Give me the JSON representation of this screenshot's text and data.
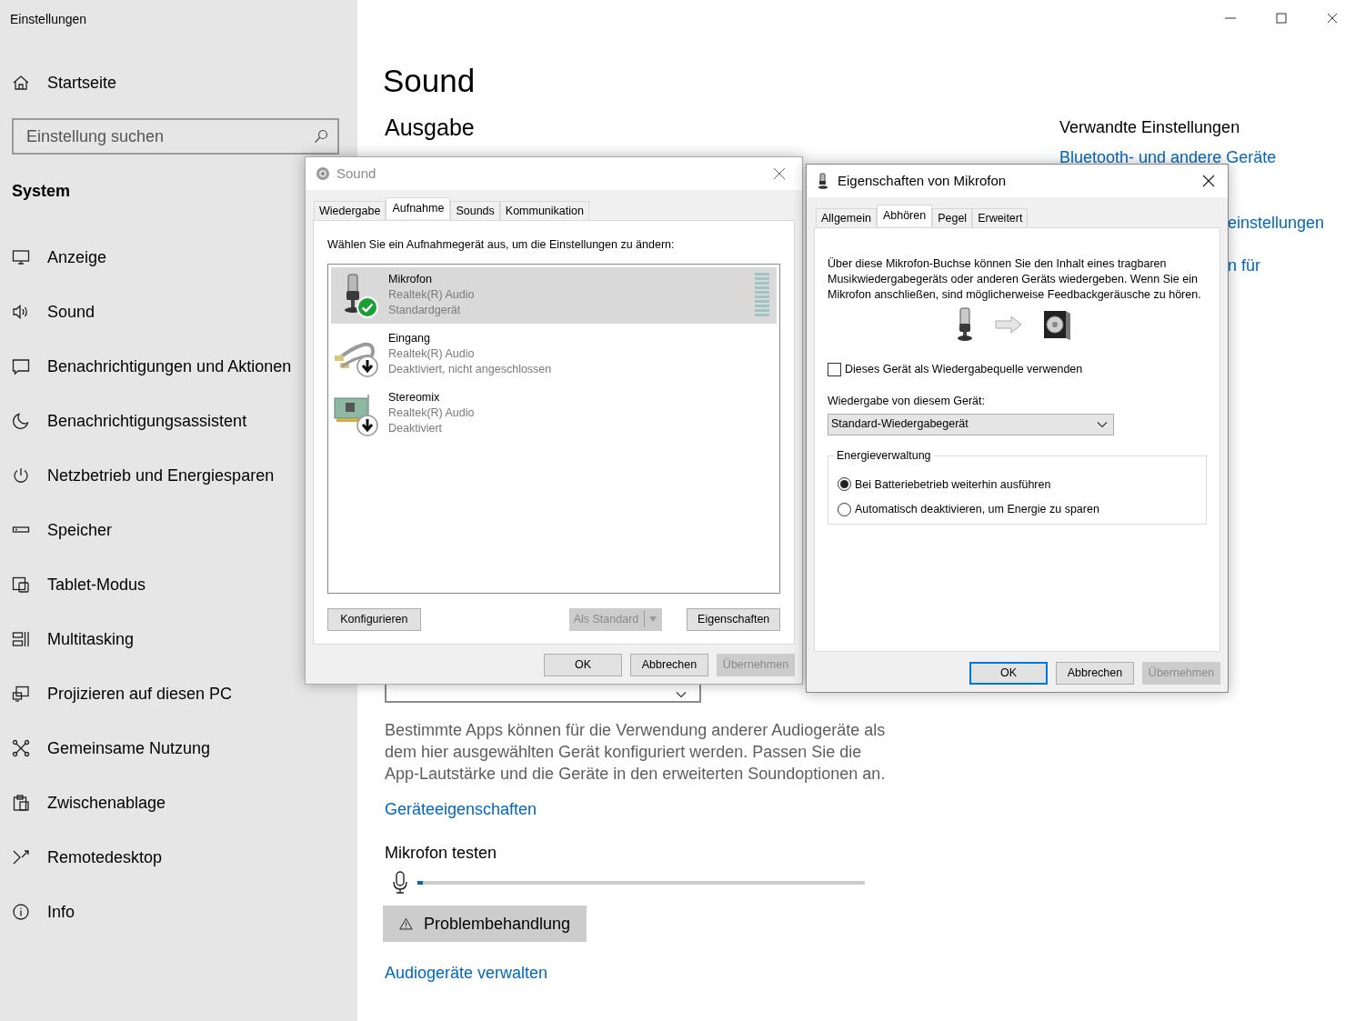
{
  "window": {
    "title": "Einstellungen"
  },
  "sidebar": {
    "home": "Startseite",
    "search": {
      "placeholder": "Einstellung suchen"
    },
    "section": "System",
    "items": [
      {
        "label": "Anzeige"
      },
      {
        "label": "Sound"
      },
      {
        "label": "Benachrichtigungen und Aktionen"
      },
      {
        "label": "Benachrichtigungsassistent"
      },
      {
        "label": "Netzbetrieb und Energiesparen"
      },
      {
        "label": "Speicher"
      },
      {
        "label": "Tablet-Modus"
      },
      {
        "label": "Multitasking"
      },
      {
        "label": "Projizieren auf diesen PC"
      },
      {
        "label": "Gemeinsame Nutzung"
      },
      {
        "label": "Zwischenablage"
      },
      {
        "label": "Remotedesktop"
      },
      {
        "label": "Info"
      }
    ]
  },
  "page": {
    "title": "Sound",
    "output_heading": "Ausgabe",
    "description": "Bestimmte Apps können für die Verwendung anderer Audiogeräte als dem hier ausgewählten Gerät konfiguriert werden. Passen Sie die App-Lautstärke und die Geräte in den erweiterten Soundoptionen an.",
    "device_properties_link": "Geräteeigenschaften",
    "test_heading": "Mikrofon testen",
    "test_meter": {
      "level": 0.012
    },
    "troubleshoot_button": "Problembehandlung",
    "manage_link": "Audiogeräte verwalten"
  },
  "related": {
    "heading": "Verwandte Einstellungen",
    "link": "Bluetooth- und andere Geräte",
    "fragments": [
      "einstellungen",
      "n für"
    ]
  },
  "sound_dialog": {
    "title": "Sound",
    "tabs": [
      {
        "label": "Wiedergabe",
        "selected": false
      },
      {
        "label": "Aufnahme",
        "selected": true
      },
      {
        "label": "Sounds",
        "selected": false
      },
      {
        "label": "Kommunikation",
        "selected": false
      }
    ],
    "instruction": "Wählen Sie ein Aufnahmegerät aus, um die Einstellungen zu ändern:",
    "devices": [
      {
        "name": "Mikrofon",
        "driver": "Realtek(R) Audio",
        "status": "Standardgerät",
        "kind": "microphone",
        "disabled": false,
        "selected": true
      },
      {
        "name": "Eingang",
        "driver": "Realtek(R) Audio",
        "status": "Deaktiviert, nicht angeschlossen",
        "kind": "cable",
        "disabled": true,
        "selected": false
      },
      {
        "name": "Stereomix",
        "driver": "Realtek(R) Audio",
        "status": "Deaktiviert",
        "kind": "card",
        "disabled": true,
        "selected": false
      }
    ],
    "buttons": [
      {
        "label": "Konfigurieren",
        "disabled": false,
        "kind": "plain"
      },
      {
        "label": "Als Standard",
        "disabled": true,
        "kind": "split"
      },
      {
        "label": "Eigenschaften",
        "disabled": false,
        "kind": "plain"
      }
    ],
    "footer_buttons": [
      {
        "label": "OK",
        "disabled": false,
        "default": false
      },
      {
        "label": "Abbrechen",
        "disabled": false,
        "default": false
      },
      {
        "label": "Übernehmen",
        "disabled": true,
        "default": false
      }
    ]
  },
  "properties_dialog": {
    "title": "Eigenschaften von Mikrofon",
    "tabs": [
      {
        "label": "Allgemein",
        "selected": false
      },
      {
        "label": "Abhören",
        "selected": true
      },
      {
        "label": "Pegel",
        "selected": false
      },
      {
        "label": "Erweitert",
        "selected": false
      }
    ],
    "description": "Über diese Mikrofon-Buchse können Sie den Inhalt eines tragbaren Musikwiedergabegeräts oder anderen Geräts wiedergeben. Wenn Sie ein Mikrofon anschließen, sind möglicherweise Feedbackgeräusche zu hören.",
    "play_through": {
      "label": "Dieses Gerät als Wiedergabequelle verwenden",
      "checked": false
    },
    "playback_label": "Wiedergabe von diesem Gerät:",
    "playback_device": {
      "value": "Standard-Wiedergabegerät"
    },
    "power": {
      "legend": "Energieverwaltung",
      "options": [
        {
          "label": "Bei Batteriebetrieb weiterhin ausführen",
          "selected": true
        },
        {
          "label": "Automatisch deaktivieren, um Energie zu sparen",
          "selected": false
        }
      ]
    },
    "footer_buttons": [
      {
        "label": "OK",
        "disabled": false,
        "default": true
      },
      {
        "label": "Abbrechen",
        "disabled": false,
        "default": false
      },
      {
        "label": "Übernehmen",
        "disabled": true,
        "default": false
      }
    ]
  }
}
